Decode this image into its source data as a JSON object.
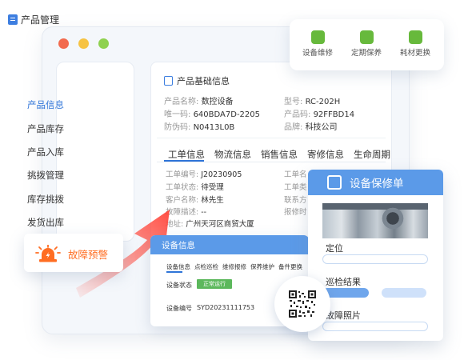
{
  "colors": {
    "accent_blue": "#2f74d8",
    "header_blue": "#5b9ae8",
    "alert_orange": "#ff6d22",
    "success_green": "#5cb85c",
    "toolbar_green": "#67b93c"
  },
  "window_controls": [
    "close",
    "minimize",
    "maximize"
  ],
  "quick_actions": [
    {
      "label": "设备维修",
      "icon": "repair-icon"
    },
    {
      "label": "定期保养",
      "icon": "maintenance-icon"
    },
    {
      "label": "耗材更换",
      "icon": "consumable-icon"
    }
  ],
  "sidebar": {
    "title": "产品管理",
    "items": [
      {
        "label": "产品信息",
        "active": true
      },
      {
        "label": "产品库存",
        "active": false
      },
      {
        "label": "产品入库",
        "active": false
      },
      {
        "label": "挑拨管理",
        "active": false
      },
      {
        "label": "库存挑拨",
        "active": false
      },
      {
        "label": "发货出库",
        "active": false
      }
    ]
  },
  "basic_info": {
    "title": "产品基础信息",
    "rows": [
      {
        "label": "产品名称:",
        "value": "数控设备"
      },
      {
        "label": "型号:",
        "value": "RC-202H"
      },
      {
        "label": "唯一码:",
        "value": "640BDA7D-2205"
      },
      {
        "label": "产品码:",
        "value": "92FFBD14"
      },
      {
        "label": "防伪码:",
        "value": "N0413L0B"
      },
      {
        "label": "品牌:",
        "value": "科技公司"
      }
    ]
  },
  "detail_tabs": [
    "工单信息",
    "物流信息",
    "销售信息",
    "寄修信息",
    "生命周期"
  ],
  "work_order": {
    "left": [
      {
        "label": "工单编号:",
        "value": "J20230905"
      },
      {
        "label": "工单状态:",
        "value": "待受理"
      },
      {
        "label": "客户名称:",
        "value": "林先生"
      },
      {
        "label": "故障描述:",
        "value": "--"
      }
    ],
    "right_labels": [
      "工单名",
      "工单类",
      "联系方",
      "报修时"
    ],
    "address_label": "地址:",
    "address_value": "广州天河区商贸大厦"
  },
  "device_card": {
    "title": "设备信息",
    "tabs": [
      "设备信息",
      "点检巡检",
      "维修报修",
      "保养维护",
      "备件更换"
    ],
    "status_label": "设备状态",
    "status_value": "正常运行",
    "number_label": "设备编号",
    "number_value": "SYD20231111753"
  },
  "repair_order": {
    "title": "设备保修单",
    "fields": [
      "定位",
      "巡检结果",
      "故障照片"
    ]
  },
  "alert": {
    "label": "故障预警"
  }
}
